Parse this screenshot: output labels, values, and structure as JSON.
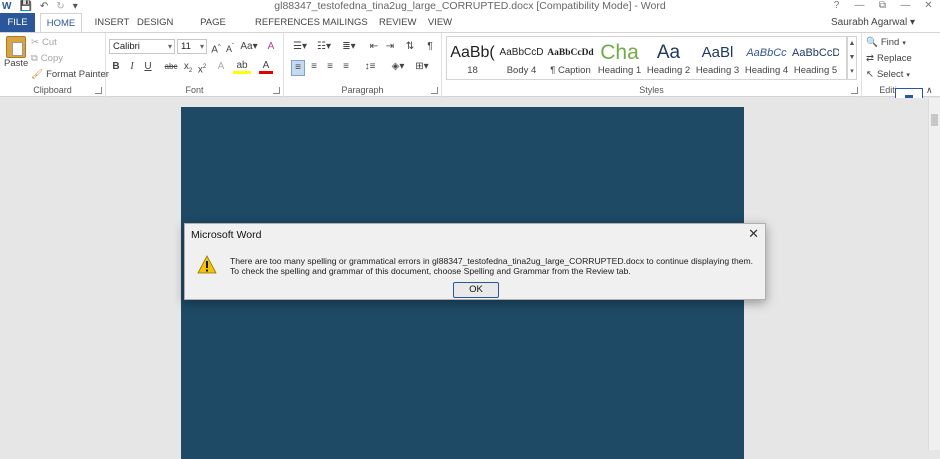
{
  "window": {
    "title": "gl88347_testofedna_tina2ug_large_CORRUPTED.docx [Compatibility Mode] - Word",
    "controls": [
      "?",
      "—",
      "⧉",
      "—",
      "✕"
    ]
  },
  "qat": {
    "word": "W",
    "save": "💾",
    "undo": "↶",
    "redo": "↻",
    "customize": "▾"
  },
  "tabs": [
    "FILE",
    "HOME",
    "INSERT",
    "DESIGN",
    "PAGE LAYOUT",
    "REFERENCES",
    "MAILINGS",
    "REVIEW",
    "VIEW"
  ],
  "user": "Saurabh Agarwal",
  "clipboard": {
    "label": "Clipboard",
    "paste": "Paste",
    "cut": "Cut",
    "copy": "Copy",
    "format_painter": "Format Painter"
  },
  "font": {
    "label": "Font",
    "family": "Calibri",
    "size": "11"
  },
  "paragraph": {
    "label": "Paragraph"
  },
  "styles": {
    "label": "Styles",
    "items": [
      {
        "preview": "AaBb(",
        "name": "18"
      },
      {
        "preview": "AaBbCcD",
        "name": "Body 4"
      },
      {
        "preview": "AaBbCcDd",
        "name": "¶ Caption"
      },
      {
        "preview": "Cha",
        "name": "Heading 1"
      },
      {
        "preview": "Aa",
        "name": "Heading 2"
      },
      {
        "preview": "AaBl",
        "name": "Heading 3"
      },
      {
        "preview": "AaBbCc",
        "name": "Heading 4"
      },
      {
        "preview": "AaBbCcD",
        "name": "Heading 5"
      }
    ]
  },
  "editing": {
    "label": "Editing",
    "find": "Find",
    "replace": "Replace",
    "select": "Select"
  },
  "dialog": {
    "title": "Microsoft Word",
    "message": "There are too many spelling or grammatical errors in gl88347_testofedna_tina2ug_large_CORRUPTED.docx to continue displaying them. To check the spelling and grammar of this document, choose Spelling and Grammar from the Review tab.",
    "ok": "OK"
  },
  "colors": {
    "accent": "#2b579a",
    "page": "#1e4a66",
    "warning": "#f5c400"
  }
}
